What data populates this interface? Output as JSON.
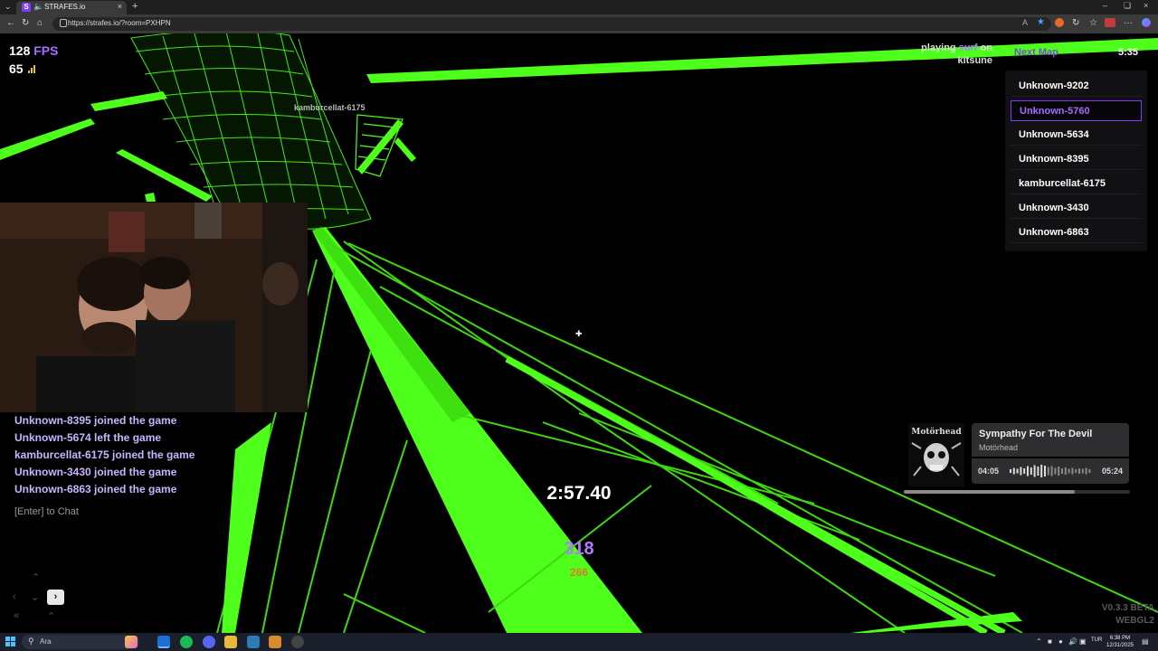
{
  "browser": {
    "tab_title": "STRAFES.io",
    "favicon_letter": "S",
    "url": "https://strafes.io/?room=PXHPN"
  },
  "hud": {
    "fps_value": "128",
    "fps_unit": "FPS",
    "ping": "65",
    "playing_prefix": "playing",
    "game_mode": "surf",
    "playing_suffix": "on",
    "map_name": "kitsune",
    "next_map_label": "Next Map",
    "countdown": "5:35",
    "run_timer": "2:57.40",
    "speed": "318",
    "speed_secondary": "266",
    "version": "V0.3.3 BETA",
    "renderer": "WEBGL2"
  },
  "scoreboard": [
    {
      "name": "Unknown-9202",
      "self": false
    },
    {
      "name": "Unknown-5760",
      "self": true
    },
    {
      "name": "Unknown-5634",
      "self": false
    },
    {
      "name": "Unknown-8395",
      "self": false
    },
    {
      "name": "kamburcellat-6175",
      "self": false
    },
    {
      "name": "Unknown-3430",
      "self": false
    },
    {
      "name": "Unknown-6863",
      "self": false
    }
  ],
  "world_nametag": "kamburcellat-6175",
  "chat": {
    "messages": [
      "Unknown-8395 joined the game",
      "Unknown-5674 left the game",
      "kamburcellat-6175 joined the game",
      "Unknown-3430 joined the game",
      "Unknown-6863 joined the game"
    ],
    "input_hint": "[Enter] to Chat"
  },
  "music": {
    "title": "Sympathy For The Devil",
    "artist": "Motörhead",
    "time_now": "04:05",
    "time_total": "05:24",
    "progress": 0.756
  },
  "taskbar": {
    "search_placeholder": "Ara",
    "language": "TUR",
    "time": "6:38 PM",
    "date": "12/31/2025"
  },
  "colors": {
    "accent_purple": "#a46cff",
    "surf_green": "#4dff1a",
    "speed_orange": "#e07a2a"
  }
}
